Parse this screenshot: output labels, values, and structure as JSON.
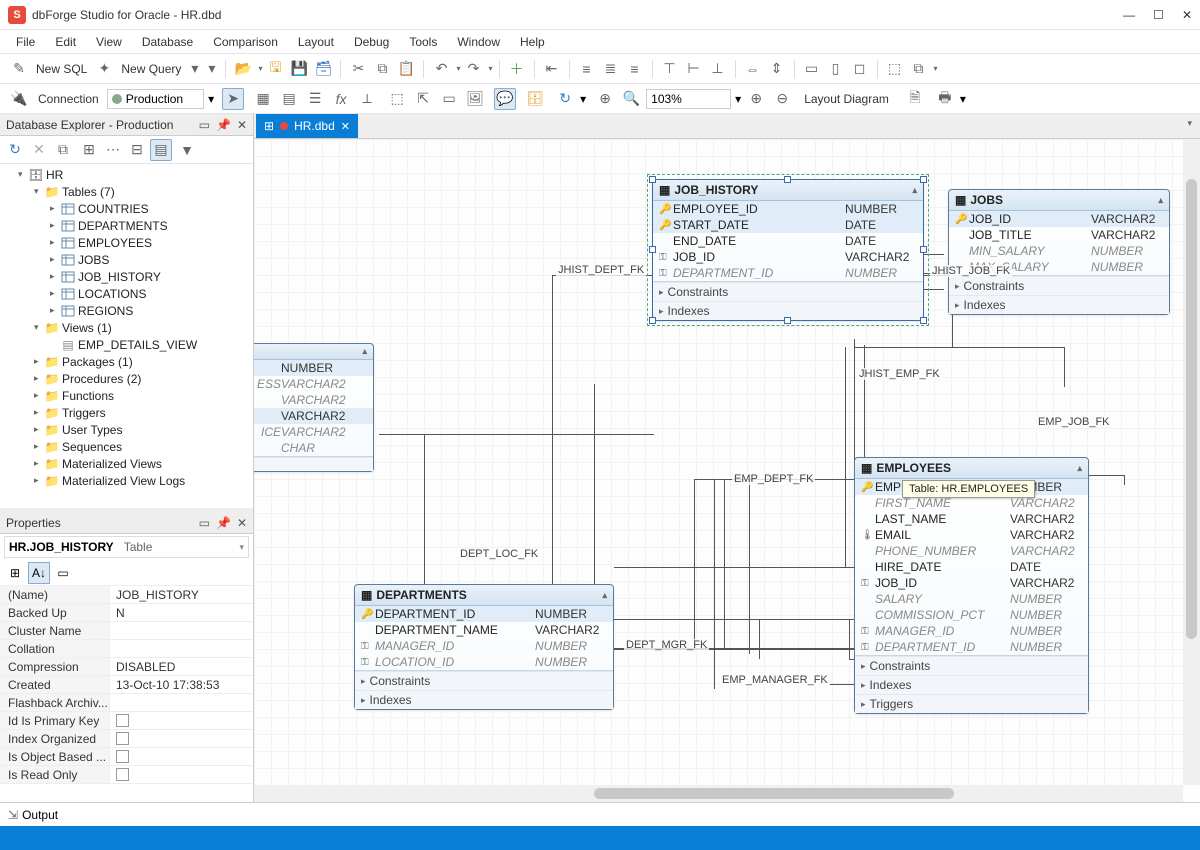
{
  "app": {
    "title": "dbForge Studio for Oracle - HR.dbd",
    "logo_letter": "S"
  },
  "menu": [
    "File",
    "Edit",
    "View",
    "Database",
    "Comparison",
    "Layout",
    "Debug",
    "Tools",
    "Window",
    "Help"
  ],
  "toolbar1": {
    "new_sql": "New SQL",
    "new_query": "New Query"
  },
  "connection_row": {
    "label": "Connection",
    "name": "Production",
    "zoom": "103%",
    "layout_btn": "Layout Diagram"
  },
  "explorer": {
    "title": "Database Explorer - Production",
    "root": "HR",
    "tables_label": "Tables (7)",
    "tables": [
      "COUNTRIES",
      "DEPARTMENTS",
      "EMPLOYEES",
      "JOBS",
      "JOB_HISTORY",
      "LOCATIONS",
      "REGIONS"
    ],
    "views_label": "Views (1)",
    "views": [
      "EMP_DETAILS_VIEW"
    ],
    "folders": [
      "Packages (1)",
      "Procedures (2)",
      "Functions",
      "Triggers",
      "User Types",
      "Sequences",
      "Materialized Views",
      "Materialized View Logs"
    ]
  },
  "properties": {
    "title": "Properties",
    "path_schema": "HR.JOB_HISTORY",
    "path_type": "Table",
    "rows": [
      {
        "name": "(Name)",
        "value": "JOB_HISTORY"
      },
      {
        "name": "Backed Up",
        "value": "N"
      },
      {
        "name": "Cluster Name",
        "value": ""
      },
      {
        "name": "Collation",
        "value": ""
      },
      {
        "name": "Compression",
        "value": "DISABLED"
      },
      {
        "name": "Created",
        "value": "13-Oct-10 17:38:53"
      },
      {
        "name": "Flashback Archiv...",
        "value": ""
      },
      {
        "name": "Id Is Primary Key",
        "value": "",
        "checkbox": true
      },
      {
        "name": "Index Organized",
        "value": "",
        "checkbox": true
      },
      {
        "name": "Is Object Based ...",
        "value": "",
        "checkbox": true
      },
      {
        "name": "Is Read Only",
        "value": "",
        "checkbox": true
      }
    ]
  },
  "tab": {
    "name": "HR.dbd"
  },
  "diagram": {
    "partial_table": {
      "cols": [
        {
          "name": "",
          "type": "NUMBER",
          "hl": true
        },
        {
          "name": "ESS",
          "type": "VARCHAR2",
          "fk": true
        },
        {
          "name": "",
          "type": "VARCHAR2",
          "fk": true
        },
        {
          "name": "",
          "type": "VARCHAR2",
          "hl": true
        },
        {
          "name": "ICE",
          "type": "VARCHAR2",
          "fk": true
        },
        {
          "name": "",
          "type": "CHAR",
          "fk": true
        }
      ]
    },
    "job_history": {
      "title": "JOB_HISTORY",
      "cols": [
        {
          "icon": "pk",
          "name": "EMPLOYEE_ID",
          "type": "NUMBER",
          "hl": true
        },
        {
          "icon": "pk",
          "name": "START_DATE",
          "type": "DATE",
          "hl": true
        },
        {
          "icon": "",
          "name": "END_DATE",
          "type": "DATE"
        },
        {
          "icon": "fk",
          "name": "JOB_ID",
          "type": "VARCHAR2"
        },
        {
          "icon": "fk",
          "name": "DEPARTMENT_ID",
          "type": "NUMBER",
          "fk": true
        }
      ],
      "sections": [
        "Constraints",
        "Indexes"
      ]
    },
    "jobs": {
      "title": "JOBS",
      "cols": [
        {
          "icon": "pk",
          "name": "JOB_ID",
          "type": "VARCHAR2",
          "hl": true
        },
        {
          "icon": "",
          "name": "JOB_TITLE",
          "type": "VARCHAR2"
        },
        {
          "icon": "",
          "name": "MIN_SALARY",
          "type": "NUMBER",
          "fk": true
        },
        {
          "icon": "",
          "name": "MAX_SALARY",
          "type": "NUMBER",
          "fk": true
        }
      ],
      "sections": [
        "Constraints",
        "Indexes"
      ]
    },
    "departments": {
      "title": "DEPARTMENTS",
      "cols": [
        {
          "icon": "pk",
          "name": "DEPARTMENT_ID",
          "type": "NUMBER",
          "hl": true
        },
        {
          "icon": "",
          "name": "DEPARTMENT_NAME",
          "type": "VARCHAR2"
        },
        {
          "icon": "fk",
          "name": "MANAGER_ID",
          "type": "NUMBER",
          "fk": true
        },
        {
          "icon": "fk",
          "name": "LOCATION_ID",
          "type": "NUMBER",
          "fk": true
        }
      ],
      "sections": [
        "Constraints",
        "Indexes"
      ]
    },
    "employees": {
      "title": "EMPLOYEES",
      "cols": [
        {
          "icon": "pk",
          "name": "EMPLOYEE_ID",
          "type": "NUMBER",
          "hl": true
        },
        {
          "icon": "",
          "name": "FIRST_NAME",
          "type": "VARCHAR2",
          "fk": true
        },
        {
          "icon": "",
          "name": "LAST_NAME",
          "type": "VARCHAR2"
        },
        {
          "icon": "idx",
          "name": "EMAIL",
          "type": "VARCHAR2"
        },
        {
          "icon": "",
          "name": "PHONE_NUMBER",
          "type": "VARCHAR2",
          "fk": true
        },
        {
          "icon": "",
          "name": "HIRE_DATE",
          "type": "DATE"
        },
        {
          "icon": "fk",
          "name": "JOB_ID",
          "type": "VARCHAR2"
        },
        {
          "icon": "",
          "name": "SALARY",
          "type": "NUMBER",
          "fk": true
        },
        {
          "icon": "",
          "name": "COMMISSION_PCT",
          "type": "NUMBER",
          "fk": true
        },
        {
          "icon": "fk",
          "name": "MANAGER_ID",
          "type": "NUMBER",
          "fk": true
        },
        {
          "icon": "fk",
          "name": "DEPARTMENT_ID",
          "type": "NUMBER",
          "fk": true
        }
      ],
      "sections": [
        "Constraints",
        "Indexes",
        "Triggers"
      ]
    },
    "rel_labels": {
      "jhist_dept_fk": "JHIST_DEPT_FK",
      "jhist_job_fk": "JHIST_JOB_FK",
      "jhist_emp_fk": "JHIST_EMP_FK",
      "dept_loc_fk": "DEPT_LOC_FK",
      "dept_mgr_fk": "DEPT_MGR_FK",
      "emp_dept_fk": "EMP_DEPT_FK",
      "emp_job_fk": "EMP_JOB_FK",
      "emp_manager_fk": "EMP_MANAGER_FK"
    },
    "tooltip": "Table: HR.EMPLOYEES"
  },
  "output": {
    "label": "Output"
  }
}
